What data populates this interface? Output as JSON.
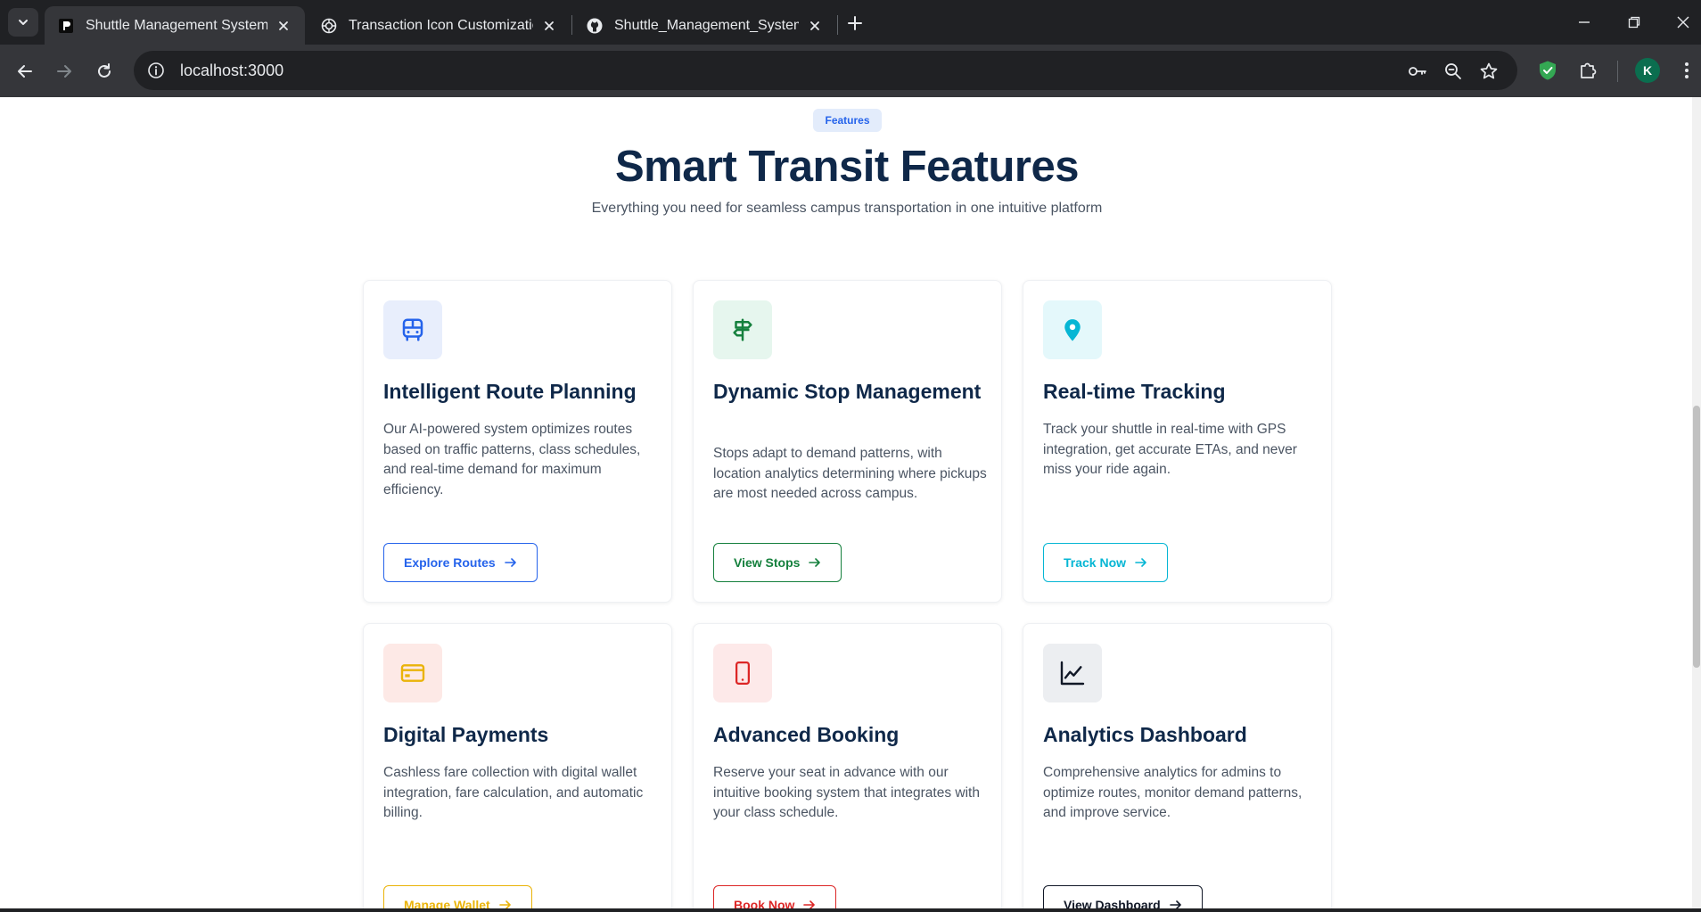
{
  "browser": {
    "tabs": [
      {
        "title": "Shuttle Management System",
        "active": true,
        "icon": "brand-p-icon"
      },
      {
        "title": "Transaction Icon Customization",
        "active": false,
        "icon": "openai-icon"
      },
      {
        "title": "Shuttle_Management_System/fr",
        "active": false,
        "icon": "github-icon"
      }
    ],
    "url": "localhost:3000",
    "profile_initial": "K"
  },
  "page": {
    "badge": "Features",
    "headline": "Smart Transit Features",
    "subheadline": "Everything you need for seamless campus transportation in one intuitive platform"
  },
  "cards": [
    {
      "title": "Intelligent Route Planning",
      "description": "Our AI-powered system optimizes routes based on traffic patterns, class schedules, and real-time demand for maximum efficiency.",
      "button": "Explore Routes",
      "icon": "bus-icon",
      "accent": "#2563eb",
      "icon_bg": "#e8eefc"
    },
    {
      "title": "Dynamic Stop Management",
      "description": "Stops adapt to demand patterns, with location analytics determining where pickups are most needed across campus.",
      "button": "View Stops",
      "icon": "signpost-icon",
      "accent": "#15803d",
      "icon_bg": "#e6f6ee"
    },
    {
      "title": "Real-time Tracking",
      "description": "Track your shuttle in real-time with GPS integration, get accurate ETAs, and never miss your ride again.",
      "button": "Track Now",
      "icon": "map-pin-icon",
      "accent": "#06b6d4",
      "icon_bg": "#e4f8fb"
    },
    {
      "title": "Digital Payments",
      "description": "Cashless fare collection with digital wallet integration, fare calculation, and automatic billing.",
      "button": "Manage Wallet",
      "icon": "credit-card-icon",
      "accent": "#eab308",
      "icon_bg": "#fde9e6"
    },
    {
      "title": "Advanced Booking",
      "description": "Reserve your seat in advance with our intuitive booking system that integrates with your class schedule.",
      "button": "Book Now",
      "icon": "smartphone-icon",
      "accent": "#dc2626",
      "icon_bg": "#fde9e9"
    },
    {
      "title": "Analytics Dashboard",
      "description": "Comprehensive analytics for admins to optimize routes, monitor demand patterns, and improve service.",
      "button": "View Dashboard",
      "icon": "line-chart-icon",
      "accent": "#111827",
      "icon_bg": "#eceef1"
    }
  ]
}
